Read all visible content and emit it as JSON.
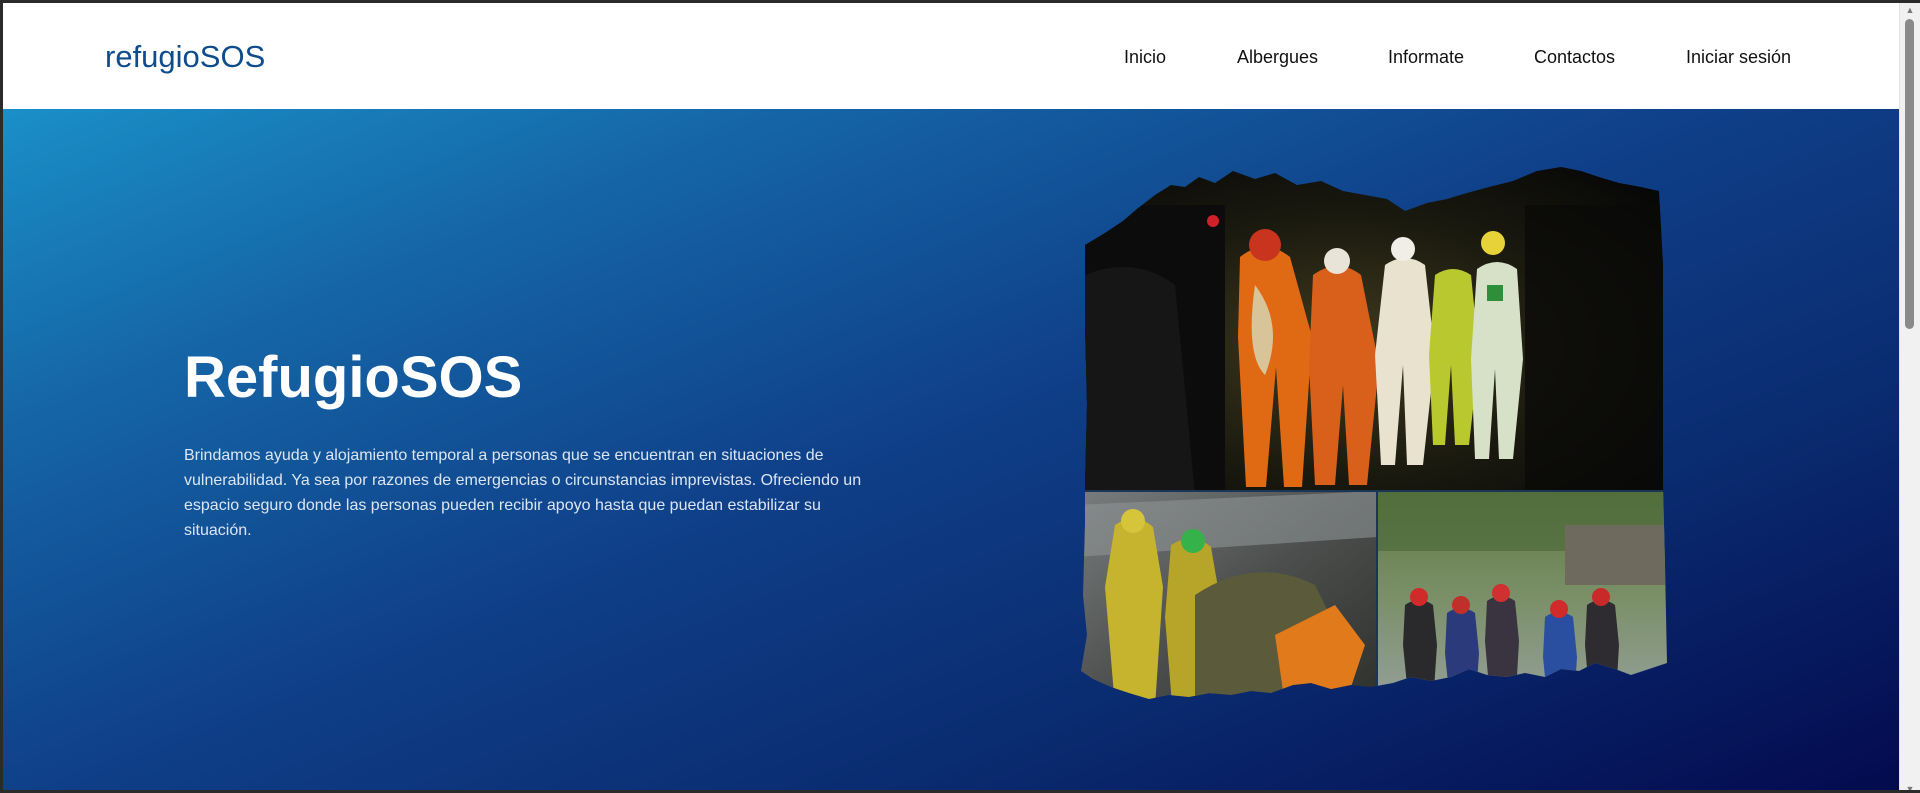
{
  "navbar": {
    "brand": "refugioSOS",
    "links": [
      "Inicio",
      "Albergues",
      "Informate",
      "Contactos",
      "Iniciar sesión"
    ]
  },
  "hero": {
    "title": "RefugioSOS",
    "description": "Brindamos ayuda y alojamiento temporal a personas que se encuentran en situaciones de vulnerabilidad. Ya sea por razones de emergencias o circunstancias imprevistas. Ofreciendo un espacio seguro donde las personas pueden recibir apoyo hasta que puedan estabilizar su situación."
  },
  "colors": {
    "brand": "#0f4c8c",
    "hero_gradient_start": "#1a8fc8",
    "hero_gradient_end": "#040a4e"
  }
}
